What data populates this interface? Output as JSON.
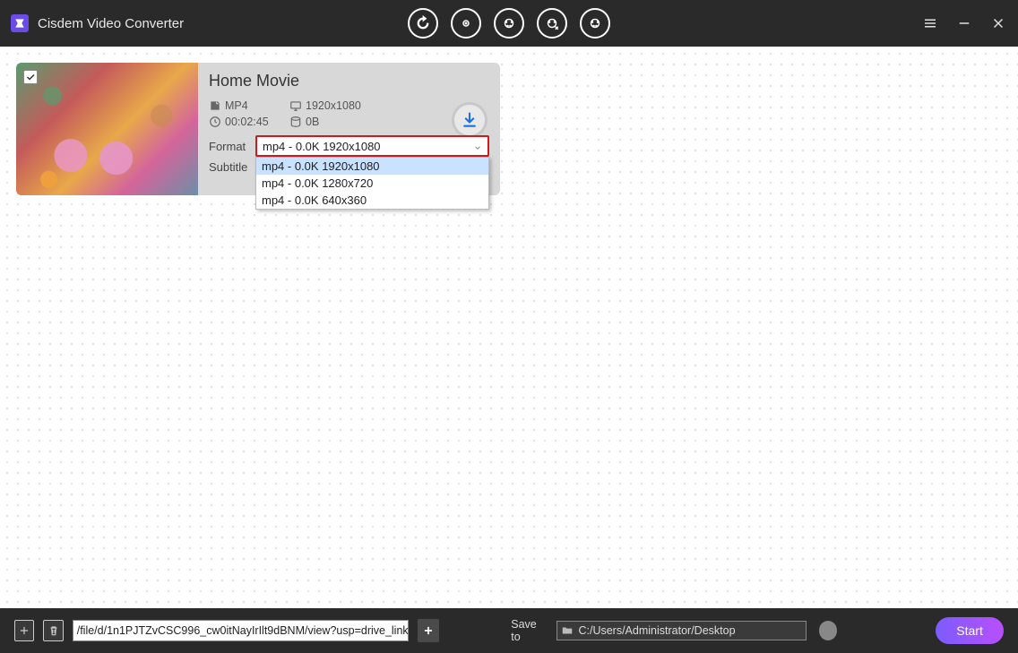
{
  "app": {
    "title": "Cisdem Video Converter"
  },
  "topbar": {
    "icons": [
      "convert-icon",
      "download-icon",
      "edit-icon",
      "rip-icon",
      "burn-icon"
    ]
  },
  "window_controls": {
    "menu": "menu",
    "minimize": "minimize",
    "close": "close"
  },
  "card": {
    "title": "Home Movie",
    "container": "MP4",
    "resolution": "1920x1080",
    "duration": "00:02:45",
    "size": "0B",
    "format_label": "Format",
    "subtitle_label": "Subtitle",
    "format_selected": "mp4 - 0.0K 1920x1080",
    "format_options": [
      "mp4 - 0.0K 1920x1080",
      "mp4 - 0.0K 1280x720",
      "mp4 - 0.0K 640x360"
    ]
  },
  "bottom": {
    "url": "/file/d/1n1PJTZvCSC996_cw0itNayIrIlt9dBNM/view?usp=drive_link",
    "saveto_label": "Save to",
    "save_path": "C:/Users/Administrator/Desktop",
    "start_label": "Start"
  }
}
